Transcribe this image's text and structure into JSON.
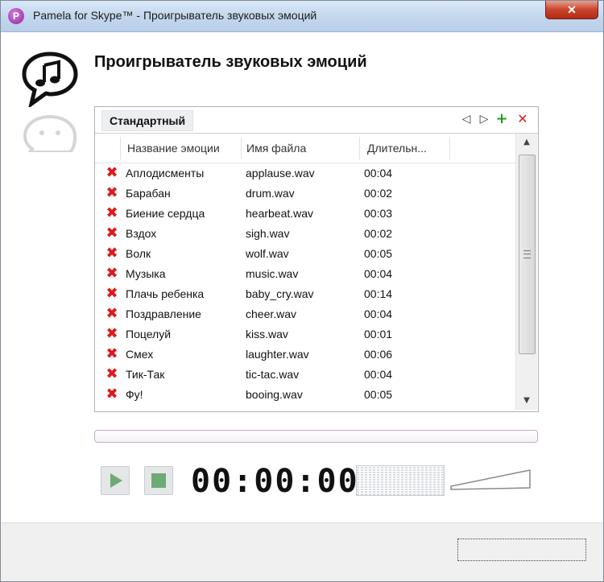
{
  "window": {
    "title": "Pamela for Skype™ - Проигрыватель звуковых эмоций",
    "app_icon_letter": "P",
    "close_glyph": "✕"
  },
  "page": {
    "title": "Проигрыватель звуковых эмоций"
  },
  "tabs": [
    {
      "label": "Стандартный",
      "selected": true
    }
  ],
  "tab_controls": {
    "prev": "◁",
    "next": "▷",
    "add": "+",
    "delete": "✕"
  },
  "table": {
    "columns": [
      "Название эмоции",
      "Имя файла",
      "Длительн..."
    ],
    "rows": [
      {
        "name": "Аплодисменты",
        "file": "applause.wav",
        "duration": "00:04"
      },
      {
        "name": "Барабан",
        "file": "drum.wav",
        "duration": "00:02"
      },
      {
        "name": "Биение сердца",
        "file": "hearbeat.wav",
        "duration": "00:03"
      },
      {
        "name": "Вздох",
        "file": "sigh.wav",
        "duration": "00:02"
      },
      {
        "name": "Волк",
        "file": "wolf.wav",
        "duration": "00:05"
      },
      {
        "name": "Музыка",
        "file": "music.wav",
        "duration": "00:04"
      },
      {
        "name": "Плачь ребенка",
        "file": "baby_cry.wav",
        "duration": "00:14"
      },
      {
        "name": "Поздравление",
        "file": "cheer.wav",
        "duration": "00:04"
      },
      {
        "name": "Поцелуй",
        "file": "kiss.wav",
        "duration": "00:01"
      },
      {
        "name": "Смех",
        "file": "laughter.wav",
        "duration": "00:06"
      },
      {
        "name": "Тик-Так",
        "file": "tic-tac.wav",
        "duration": "00:04"
      },
      {
        "name": "Фу!",
        "file": "booing.wav",
        "duration": "00:05"
      }
    ],
    "row_icon": "✖"
  },
  "scrollbar": {
    "up": "▲",
    "down": "▼"
  },
  "player": {
    "time": "00:00:00",
    "progress": 0
  },
  "colors": {
    "accent_green": "#6eaa76",
    "delete_red": "#e01818",
    "add_green": "#1c9a1c"
  }
}
